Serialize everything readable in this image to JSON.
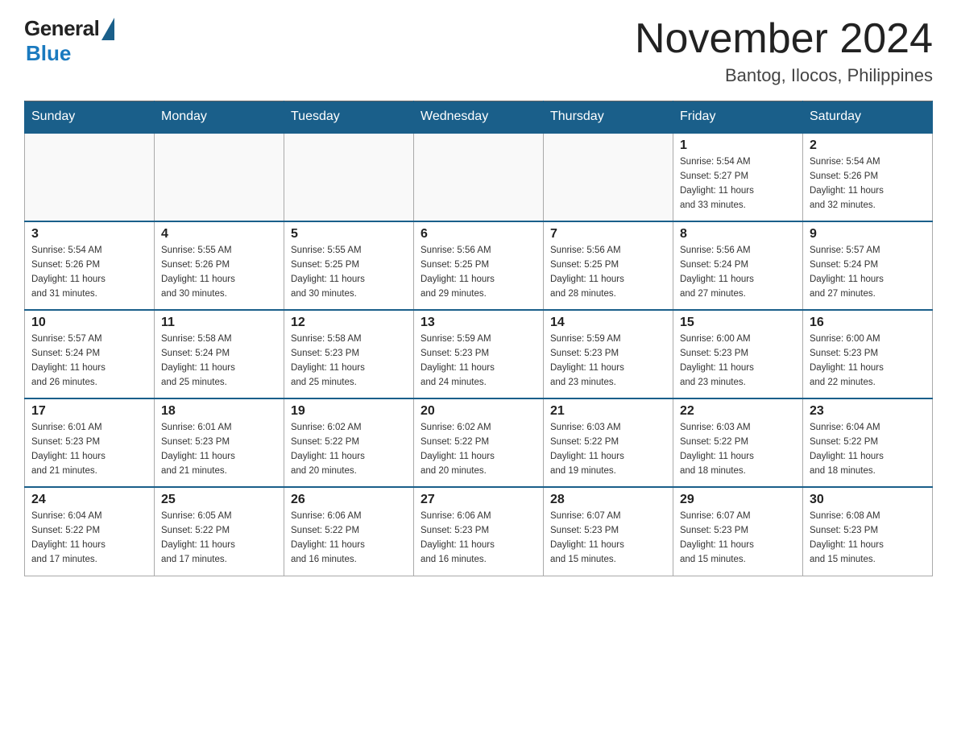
{
  "logo": {
    "general": "General",
    "blue": "Blue"
  },
  "header": {
    "month": "November 2024",
    "location": "Bantog, Ilocos, Philippines"
  },
  "days_of_week": [
    "Sunday",
    "Monday",
    "Tuesday",
    "Wednesday",
    "Thursday",
    "Friday",
    "Saturday"
  ],
  "weeks": [
    [
      {
        "day": "",
        "info": ""
      },
      {
        "day": "",
        "info": ""
      },
      {
        "day": "",
        "info": ""
      },
      {
        "day": "",
        "info": ""
      },
      {
        "day": "",
        "info": ""
      },
      {
        "day": "1",
        "info": "Sunrise: 5:54 AM\nSunset: 5:27 PM\nDaylight: 11 hours\nand 33 minutes."
      },
      {
        "day": "2",
        "info": "Sunrise: 5:54 AM\nSunset: 5:26 PM\nDaylight: 11 hours\nand 32 minutes."
      }
    ],
    [
      {
        "day": "3",
        "info": "Sunrise: 5:54 AM\nSunset: 5:26 PM\nDaylight: 11 hours\nand 31 minutes."
      },
      {
        "day": "4",
        "info": "Sunrise: 5:55 AM\nSunset: 5:26 PM\nDaylight: 11 hours\nand 30 minutes."
      },
      {
        "day": "5",
        "info": "Sunrise: 5:55 AM\nSunset: 5:25 PM\nDaylight: 11 hours\nand 30 minutes."
      },
      {
        "day": "6",
        "info": "Sunrise: 5:56 AM\nSunset: 5:25 PM\nDaylight: 11 hours\nand 29 minutes."
      },
      {
        "day": "7",
        "info": "Sunrise: 5:56 AM\nSunset: 5:25 PM\nDaylight: 11 hours\nand 28 minutes."
      },
      {
        "day": "8",
        "info": "Sunrise: 5:56 AM\nSunset: 5:24 PM\nDaylight: 11 hours\nand 27 minutes."
      },
      {
        "day": "9",
        "info": "Sunrise: 5:57 AM\nSunset: 5:24 PM\nDaylight: 11 hours\nand 27 minutes."
      }
    ],
    [
      {
        "day": "10",
        "info": "Sunrise: 5:57 AM\nSunset: 5:24 PM\nDaylight: 11 hours\nand 26 minutes."
      },
      {
        "day": "11",
        "info": "Sunrise: 5:58 AM\nSunset: 5:24 PM\nDaylight: 11 hours\nand 25 minutes."
      },
      {
        "day": "12",
        "info": "Sunrise: 5:58 AM\nSunset: 5:23 PM\nDaylight: 11 hours\nand 25 minutes."
      },
      {
        "day": "13",
        "info": "Sunrise: 5:59 AM\nSunset: 5:23 PM\nDaylight: 11 hours\nand 24 minutes."
      },
      {
        "day": "14",
        "info": "Sunrise: 5:59 AM\nSunset: 5:23 PM\nDaylight: 11 hours\nand 23 minutes."
      },
      {
        "day": "15",
        "info": "Sunrise: 6:00 AM\nSunset: 5:23 PM\nDaylight: 11 hours\nand 23 minutes."
      },
      {
        "day": "16",
        "info": "Sunrise: 6:00 AM\nSunset: 5:23 PM\nDaylight: 11 hours\nand 22 minutes."
      }
    ],
    [
      {
        "day": "17",
        "info": "Sunrise: 6:01 AM\nSunset: 5:23 PM\nDaylight: 11 hours\nand 21 minutes."
      },
      {
        "day": "18",
        "info": "Sunrise: 6:01 AM\nSunset: 5:23 PM\nDaylight: 11 hours\nand 21 minutes."
      },
      {
        "day": "19",
        "info": "Sunrise: 6:02 AM\nSunset: 5:22 PM\nDaylight: 11 hours\nand 20 minutes."
      },
      {
        "day": "20",
        "info": "Sunrise: 6:02 AM\nSunset: 5:22 PM\nDaylight: 11 hours\nand 20 minutes."
      },
      {
        "day": "21",
        "info": "Sunrise: 6:03 AM\nSunset: 5:22 PM\nDaylight: 11 hours\nand 19 minutes."
      },
      {
        "day": "22",
        "info": "Sunrise: 6:03 AM\nSunset: 5:22 PM\nDaylight: 11 hours\nand 18 minutes."
      },
      {
        "day": "23",
        "info": "Sunrise: 6:04 AM\nSunset: 5:22 PM\nDaylight: 11 hours\nand 18 minutes."
      }
    ],
    [
      {
        "day": "24",
        "info": "Sunrise: 6:04 AM\nSunset: 5:22 PM\nDaylight: 11 hours\nand 17 minutes."
      },
      {
        "day": "25",
        "info": "Sunrise: 6:05 AM\nSunset: 5:22 PM\nDaylight: 11 hours\nand 17 minutes."
      },
      {
        "day": "26",
        "info": "Sunrise: 6:06 AM\nSunset: 5:22 PM\nDaylight: 11 hours\nand 16 minutes."
      },
      {
        "day": "27",
        "info": "Sunrise: 6:06 AM\nSunset: 5:23 PM\nDaylight: 11 hours\nand 16 minutes."
      },
      {
        "day": "28",
        "info": "Sunrise: 6:07 AM\nSunset: 5:23 PM\nDaylight: 11 hours\nand 15 minutes."
      },
      {
        "day": "29",
        "info": "Sunrise: 6:07 AM\nSunset: 5:23 PM\nDaylight: 11 hours\nand 15 minutes."
      },
      {
        "day": "30",
        "info": "Sunrise: 6:08 AM\nSunset: 5:23 PM\nDaylight: 11 hours\nand 15 minutes."
      }
    ]
  ]
}
